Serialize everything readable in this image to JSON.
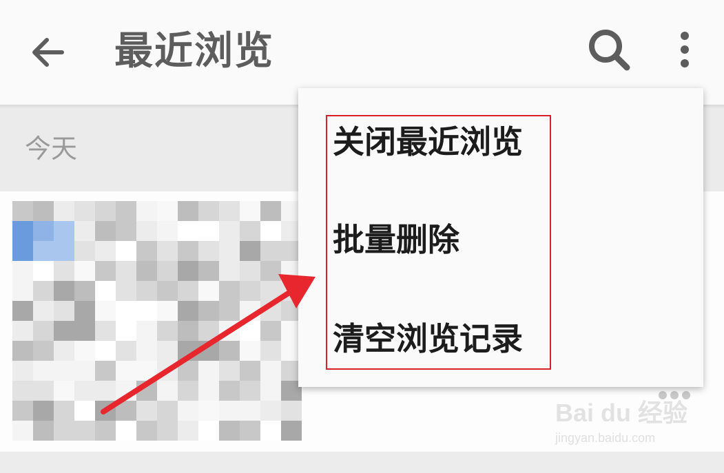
{
  "header": {
    "title": "最近浏览",
    "back_icon": "arrow-left-icon",
    "search_icon": "search-icon",
    "more_icon": "more-vertical-icon"
  },
  "section": {
    "label": "今天"
  },
  "menu": {
    "items": [
      {
        "label": "关闭最近浏览"
      },
      {
        "label": "批量删除"
      },
      {
        "label": "清空浏览记录"
      }
    ]
  },
  "annotation": {
    "highlight_color": "#d8202a",
    "arrow_color": "#e8262e"
  },
  "watermark": {
    "logo": "Bai du 经验",
    "url": "jingyan.baidu.com"
  }
}
